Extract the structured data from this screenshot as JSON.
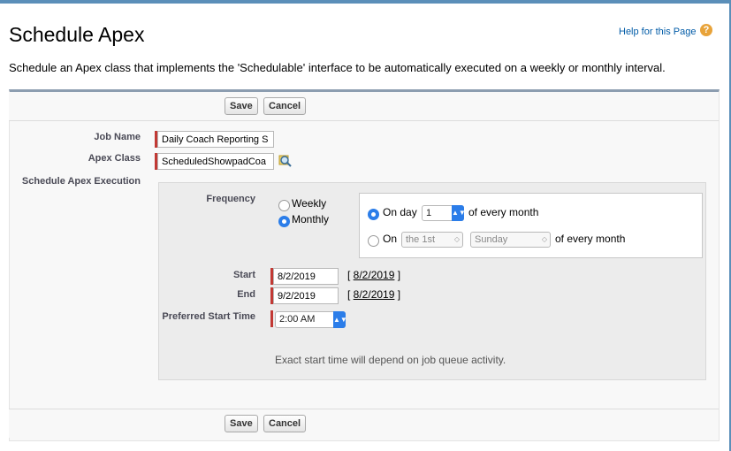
{
  "page": {
    "title": "Schedule Apex",
    "help_label": "Help for this Page",
    "help_icon": "?",
    "description": "Schedule an Apex class that implements the 'Schedulable' interface to be automatically executed on a weekly or monthly interval."
  },
  "buttons": {
    "save": "Save",
    "cancel": "Cancel"
  },
  "form": {
    "job_name_label": "Job Name",
    "job_name_value": "Daily Coach Reporting S",
    "apex_class_label": "Apex Class",
    "apex_class_value": "ScheduledShowpadCoa",
    "execution_label": "Schedule Apex Execution",
    "frequency_label": "Frequency",
    "frequency_options": [
      "Weekly",
      "Monthly"
    ],
    "frequency_selected": "Monthly",
    "on_day_label": "On day",
    "on_day_value": "1",
    "of_every_month": "of every month",
    "on_label": "On",
    "ordinal_value": "the 1st",
    "weekday_value": "Sunday",
    "start_label": "Start",
    "start_value": "8/2/2019",
    "start_link": "8/2/2019",
    "end_label": "End",
    "end_value": "9/2/2019",
    "end_link": "8/2/2019",
    "preferred_time_label": "Preferred Start Time",
    "preferred_time_value": "2:00 AM",
    "note": "Exact start time will depend on job queue activity."
  },
  "colors": {
    "accent": "#2b7de9",
    "required": "#c23934",
    "link": "#015ba7"
  }
}
